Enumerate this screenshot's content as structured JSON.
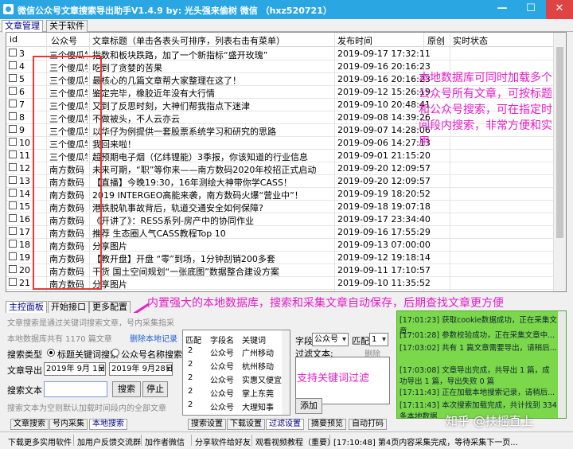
{
  "window": {
    "title": "微信公众号文章搜索导出助手V1.4.9   by: 光头强来偷树 微信 （hxz520721）",
    "min": "—",
    "max": "☐",
    "close": "✕"
  },
  "top_tabs": [
    "文章管理",
    "关于软件"
  ],
  "grid": {
    "headers": {
      "id": "id",
      "account": "公众号",
      "title": "文章标题（单击各表头可排序，列表右击有菜单）",
      "time": "发布时间",
      "orig": "原创",
      "status": "实时状态"
    },
    "rows": [
      {
        "id": "3",
        "account": "三个傻瓜学...",
        "title": "指数和板块跌路，加了一个新指标“盛开玫瑰”",
        "time": "2019-09-17 17:32:11"
      },
      {
        "id": "4",
        "account": "三个傻瓜学...",
        "title": "吃到了贪婪的苦果",
        "time": "2019-09-16 20:16:23"
      },
      {
        "id": "5",
        "account": "三个傻瓜学...",
        "title": "最核心的几篇文章帮大家整理在这了！",
        "time": "2019-09-16 20:16:23"
      },
      {
        "id": "6",
        "account": "三个傻瓜学...",
        "title": "鉴定完毕，橡胶近年没有大行情",
        "time": "2019-09-12 15:26:19"
      },
      {
        "id": "7",
        "account": "三个傻瓜学...",
        "title": "又到了反思时刻，大神们帮我指点下迷津",
        "time": "2019-09-10 20:48:41"
      },
      {
        "id": "8",
        "account": "三个傻瓜学...",
        "title": "不做被头，不人云亦云",
        "time": "2019-09-08 14:39:26"
      },
      {
        "id": "9",
        "account": "三个傻瓜学...",
        "title": "以华仔为例提供一套股票系统学习和研究的思路",
        "time": "2019-09-07 14:28:06"
      },
      {
        "id": "10",
        "account": "三个傻瓜学...",
        "title": "我回来啦！",
        "time": "2019-09-06 14:27:13"
      },
      {
        "id": "11",
        "account": "三个傻瓜学...",
        "title": "超预期电子烟（亿纬锂能）3季报，你该知道的行业信息",
        "time": "2019-09-01 21:15:20"
      },
      {
        "id": "12",
        "account": "南方数码",
        "title": "未来可期，“职”等你来——南方数码2020年校招正式启动",
        "time": "2019-09-20 12:09:57"
      },
      {
        "id": "13",
        "account": "南方数码",
        "title": "【直播】今晚19:30，16年测绘大神带你学CASS！",
        "time": "2019-09-20 12:09:57"
      },
      {
        "id": "14",
        "account": "南方数码",
        "title": "2019 INTERGEO高能来袭，南方数码火爆“营业中”！",
        "time": "2019-09-19 18:20:52"
      },
      {
        "id": "15",
        "account": "南方数码",
        "title": "港铁脱轨事故背后，轨道交通安全如何保障?",
        "time": "2019-09-18 19:07:18"
      },
      {
        "id": "16",
        "account": "南方数码",
        "title": "《开讲了》：RESS系列-房产中的协同作业",
        "time": "2019-09-17 23:34:40"
      },
      {
        "id": "17",
        "account": "南方数码",
        "title": "推荐  生态圈人气CASS教程Top 10",
        "time": "2019-09-16 17:55:29"
      },
      {
        "id": "18",
        "account": "南方数码",
        "title": "分享图片",
        "time": "2019-09-13 07:00:00"
      },
      {
        "id": "19",
        "account": "南方数码",
        "title": "【教开盘】开盘  “零”到场，1分钟刮销200多套",
        "time": "2019-09-12 19:18:14"
      },
      {
        "id": "20",
        "account": "南方数码",
        "title": "干货  国土空间规划“一张底图”数据整合建设方案",
        "time": "2019-09-11 17:10:57"
      },
      {
        "id": "21",
        "account": "南方数码",
        "title": "分享图片",
        "time": "2019-09-10 11:35:52"
      }
    ]
  },
  "notes": {
    "n1": "本地数据库可同时加载多个公众号所有文章，可按标题和公众号搜索，可在指定时间段内搜索，非常方便和实用",
    "n2": "内置强大的本地数据库，搜索和采集文章自动保存，后期查找文章更方便",
    "n3": "支持关键词过滤"
  },
  "mid_tabs": [
    "主控面板",
    "开始接口",
    "更多配置"
  ],
  "left": {
    "info": "文章搜索是通过关键词搜索文章，号内采集指采集指定公众号所有文章，本地记录指从历史搜索文章中搜索条件过滤",
    "db_count": "本地数据库共有 1170 篇文章",
    "delete_link": "删除本地记录",
    "search_type_label": "搜索类型",
    "radio1": "标题关键词搜索",
    "radio2": "公众号名称搜索",
    "export_label": "文章导出",
    "date_from": "2019年 9月 1日",
    "date_to": "2019年 9月28日",
    "search_text_label": "搜索文本",
    "search_btn": "搜索",
    "stop_btn": "停止",
    "hint": "搜索文本为空则默认加载时间段内的全部文章",
    "tabs": [
      "文章搜索",
      "号内采集",
      "本地搜索"
    ]
  },
  "match": {
    "headers": [
      "匹配",
      "字段名",
      "关键词"
    ],
    "rows": [
      [
        "2",
        "公众号",
        "广州移动"
      ],
      [
        "2",
        "公众号",
        "杭州移动"
      ],
      [
        "2",
        "公众号",
        "实惠又便宜"
      ],
      [
        "2",
        "公众号",
        "掌上东莞"
      ],
      [
        "2",
        "公众号",
        "大理知事"
      ]
    ],
    "tabs": [
      "搜索设置",
      "下载设置",
      "过滤设置",
      "摘要预览",
      "自动打码"
    ]
  },
  "filter": {
    "field_label": "字段",
    "field_value": "公众号",
    "match_label": "匹配",
    "match_value": "1",
    "text_label": "过滤文本:",
    "delete_btn": "删除",
    "add_btn": "添加"
  },
  "log": [
    "[17:01:23] 获取cookie数据成功，正在采集文章...",
    "[17:01:28] 参数校验成功，正在采集文章中...",
    "[17:03:02] 共有 1 篇文章需要导出，请稍后...",
    "[17:03:08] 文章导出完成，共导出 1 篇，成功导出 1 篇，导出失败 0 篇",
    "[17:11:43] 正在加载本地搜索记录，请稍后...",
    "[17:11:43] 本次搜索加载完成，共计找到 334 条本地数据"
  ],
  "bottom": {
    "b1": "下载更多实用软件",
    "b2": "加用户反馈交流群",
    "b3": "加作者微信",
    "b4": "分享软件给好友",
    "b5": "观看视频教程（重要）",
    "status": "[17:10:48] 第4页内容采集完成，等待采集下一页..."
  },
  "watermark": "知乎 @扶摇直上"
}
